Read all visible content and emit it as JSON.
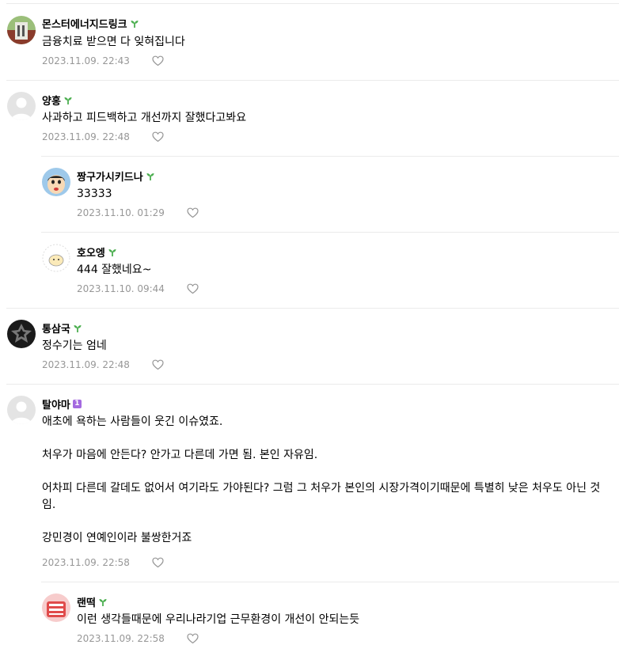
{
  "comments": [
    {
      "nick": "몬스터에너지드링크",
      "badge": "sprout",
      "text": "금융치료 받으면 다 잊혀집니다",
      "date": "2023.11.09. 22:43"
    },
    {
      "nick": "양홍",
      "badge": "sprout",
      "text": "사과하고 피드백하고 개선까지 잘했다고봐요",
      "date": "2023.11.09. 22:48"
    },
    {
      "nick": "짱구가시키드나",
      "badge": "sprout",
      "text": "33333",
      "date": "2023.11.10. 01:29"
    },
    {
      "nick": "호오엥",
      "badge": "sprout",
      "text": "444 잘했네요~",
      "date": "2023.11.10. 09:44"
    },
    {
      "nick": "통삼국",
      "badge": "sprout",
      "text": "정수기는 엄네",
      "date": "2023.11.09. 22:48"
    },
    {
      "nick": "탈야마",
      "badge": "level-1",
      "badge_text": "1",
      "text": "애초에 욕하는 사람들이 웃긴 이슈였죠.\n\n처우가 마음에 안든다? 안가고 다른데 가면 됨. 본인 자유임.\n\n어차피 다른데 갈데도 없어서 여기라도 가야된다? 그럼 그 처우가 본인의 시장가격이기때문에 특별히 낮은 처우도 아닌 것임.\n\n강민경이 연예인이라 불쌍한거죠",
      "date": "2023.11.09. 22:58"
    },
    {
      "nick": "랜떡",
      "badge": "sprout",
      "text": "이런 생각들때문에 우리나라기업 근무환경이 개선이 안되는듯",
      "date": "2023.11.09. 22:58"
    }
  ],
  "colors": {
    "badge_green": "#4caf50",
    "badge_purple": "#a46ae0",
    "meta": "#979797",
    "separator": "#ebebeb"
  }
}
